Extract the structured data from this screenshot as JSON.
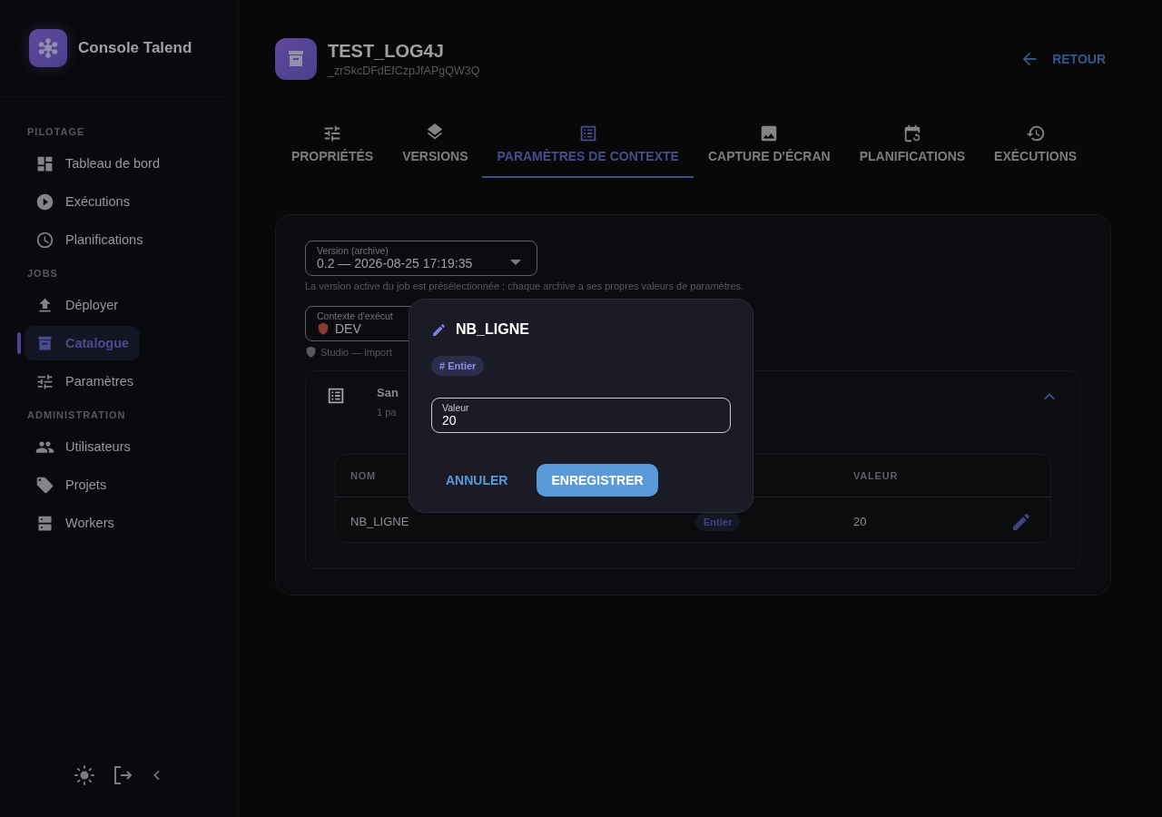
{
  "sidebar": {
    "brand": "Console Talend",
    "sections": [
      {
        "title": "PILOTAGE",
        "items": [
          {
            "label": "Tableau de bord",
            "selected": false
          },
          {
            "label": "Exécutions",
            "selected": false
          },
          {
            "label": "Planifications",
            "selected": false
          }
        ]
      },
      {
        "title": "JOBS",
        "items": [
          {
            "label": "Déployer",
            "selected": false
          },
          {
            "label": "Catalogue",
            "selected": true
          },
          {
            "label": "Paramètres",
            "selected": false
          }
        ]
      },
      {
        "title": "ADMINISTRATION",
        "items": [
          {
            "label": "Utilisateurs",
            "selected": false
          },
          {
            "label": "Projets",
            "selected": false
          },
          {
            "label": "Workers",
            "selected": false
          }
        ]
      }
    ]
  },
  "header": {
    "title": "TEST_LOG4J",
    "subtitle": "_zrSkcDFdEfCzpJfAPgQW3Q",
    "back": "RETOUR"
  },
  "tabs": [
    {
      "label": "PROPRIÉTÉS",
      "selected": false
    },
    {
      "label": "VERSIONS",
      "selected": false
    },
    {
      "label": "PARAMÈTRES DE CONTEXTE",
      "selected": true
    },
    {
      "label": "CAPTURE D'ÉCRAN",
      "selected": false
    },
    {
      "label": "PLANIFICATIONS",
      "selected": false
    },
    {
      "label": "EXÉCUTIONS",
      "selected": false
    }
  ],
  "version_field": {
    "label": "Version (archive)",
    "value": "0.2 — 2026-08-25 17:19:35",
    "helper": "La version active du job est présélectionnée ; chaque archive a ses propres valeurs de paramètres."
  },
  "context_field": {
    "label": "Contexte d'exécut",
    "value": "DEV",
    "helper": "Studio — import"
  },
  "section": {
    "title": "San",
    "subtitle": "1 pa",
    "expanded": true,
    "table": {
      "columns": [
        "NOM",
        "VALEUR"
      ],
      "rows": [
        {
          "name": "NB_LIGNE",
          "type": "Entier",
          "value": "20"
        }
      ]
    }
  },
  "dialog": {
    "title": "NB_LIGNE",
    "type": "# Entier",
    "field": {
      "label": "Valeur",
      "value": "20"
    },
    "buttons": [
      {
        "label": "ANNULER",
        "kind": "text"
      },
      {
        "label": "ENREGISTRER",
        "kind": "contained"
      }
    ]
  }
}
